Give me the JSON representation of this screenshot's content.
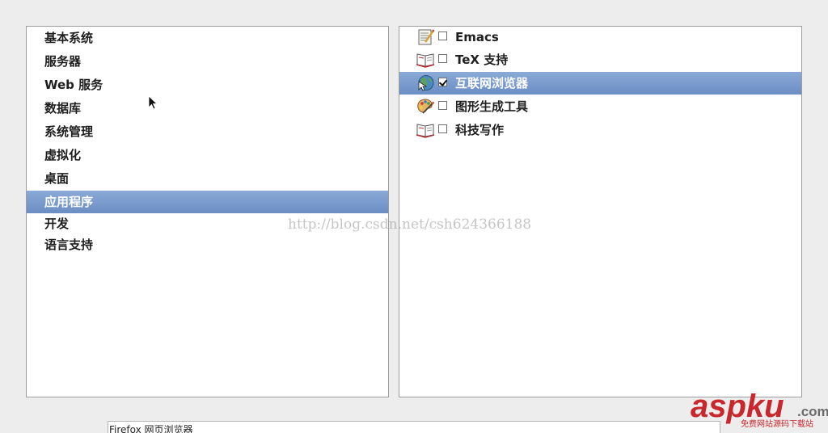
{
  "groups": [
    {
      "label": "基本系统",
      "selected": false
    },
    {
      "label": "服务器",
      "selected": false
    },
    {
      "label": "Web 服务",
      "selected": false
    },
    {
      "label": "数据库",
      "selected": false
    },
    {
      "label": "系统管理",
      "selected": false
    },
    {
      "label": "虚拟化",
      "selected": false
    },
    {
      "label": "桌面",
      "selected": false
    },
    {
      "label": "应用程序",
      "selected": true
    },
    {
      "label": "开发",
      "selected": false
    },
    {
      "label": "语言支持",
      "selected": false
    }
  ],
  "packages": [
    {
      "label": "Emacs",
      "checked": false,
      "selected": false,
      "icon": "text-editor-icon"
    },
    {
      "label": "TeX 支持",
      "checked": false,
      "selected": false,
      "icon": "book-icon"
    },
    {
      "label": "互联网浏览器",
      "checked": true,
      "selected": true,
      "icon": "web-browser-icon"
    },
    {
      "label": "图形生成工具",
      "checked": false,
      "selected": false,
      "icon": "graphics-palette-icon"
    },
    {
      "label": "科技写作",
      "checked": false,
      "selected": false,
      "icon": "book-icon"
    }
  ],
  "watermark": "http://blog.csdn.net/csh624366188",
  "description": "Firefox 网页浏览器",
  "logo": {
    "brand": "aspku",
    "suffix": ".com",
    "tagline": "免费网站源码下载站"
  },
  "colors": {
    "selection": "#7799cc",
    "logo_red": "#c8282c",
    "logo_gray": "#6b6b6b"
  }
}
